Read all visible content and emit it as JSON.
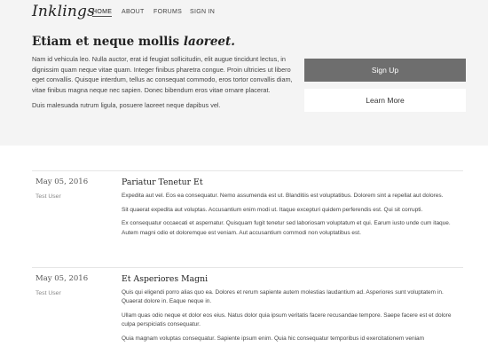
{
  "header": {
    "brand": "Inklings",
    "nav": [
      {
        "label": "HOME",
        "active": true
      },
      {
        "label": "ABOUT",
        "active": false
      },
      {
        "label": "FORUMS",
        "active": false
      },
      {
        "label": "SIGN IN",
        "active": false
      }
    ]
  },
  "hero": {
    "title_main": "Etiam et neque mollis ",
    "title_emph": "laoreet.",
    "paragraphs": [
      "Nam id vehicula leo. Nulla auctor, erat id feugiat sollicitudin, elit augue tincidunt lectus, in dignissim quam neque vitae quam. Integer finibus pharetra congue. Proin ultricies ut libero eget convallis. Quisque interdum, tellus ac consequat commodo, eros tortor convallis diam, vitae finibus magna neque nec sapien. Donec bibendum eros vitae ornare placerat.",
      "Duis malesuada rutrum ligula, posuere laoreet neque dapibus vel."
    ],
    "primary_button": "Sign Up",
    "secondary_button": "Learn More"
  },
  "posts": [
    {
      "date": "May 05, 2016",
      "author": "Test User",
      "title": "Pariatur Tenetur Et",
      "paragraphs": [
        "Expedita aut vel. Eos ea consequatur. Nemo assumenda est ut. Blanditiis est voluptatibus. Dolorem sint a repellat aut dolores.",
        "Sit quaerat expedita aut voluptas. Accusantium enim modi ut. Itaque excepturi quidem perferendis est. Qui sit corrupti.",
        "Ex consequatur occaecati et aspernatur. Quisquam fugit tenetur sed laboriosam voluptatum et qui. Earum iusto unde cum itaque. Autem magni odio et doloremque est veniam. Aut accusantium commodi non voluptatibus est."
      ]
    },
    {
      "date": "May 05, 2016",
      "author": "Test User",
      "title": "Et Asperiores Magni",
      "paragraphs": [
        "Quis qui eligendi porro alias quo ea. Dolores et rerum sapiente autem molestias laudantium ad. Asperiores sunt voluptatem in. Quaerat dolore in. Eaque neque in.",
        "Ullam quas odio neque et dolor eos eius. Natus dolor quia ipsum veritatis facere recusandae tempore. Saepe facere est et dolore culpa perspiciatis consequatur.",
        "Quia magnam voluptas consequatur. Sapiente ipsum enim. Quia hic consequatur temporibus id exercitationem veniam"
      ]
    }
  ]
}
